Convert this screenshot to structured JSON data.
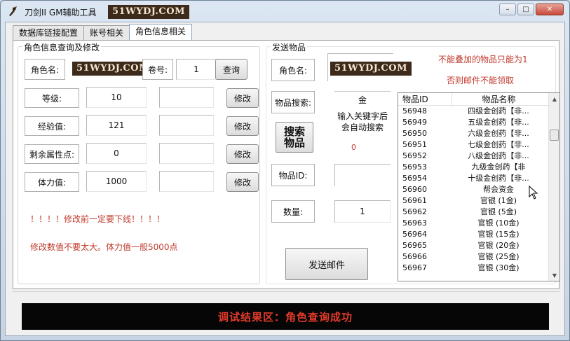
{
  "window": {
    "title": "刀剑II GM辅助工具",
    "watermark": "51WYDJ.COM",
    "controls": {
      "minimize": "–",
      "maximize": "□",
      "close": "✕"
    }
  },
  "tabs": [
    {
      "label": "数据库链接配置"
    },
    {
      "label": "账号相关"
    },
    {
      "label": "角色信息相关"
    }
  ],
  "role_query": {
    "group_title": "角色信息查询及修改",
    "name_label": "角色名:",
    "name_value": "51WYDJ.COM",
    "volume_label": "卷号:",
    "volume_value": "1",
    "query_button": "查询",
    "rows": [
      {
        "label": "等级:",
        "value": "10",
        "button": "修改"
      },
      {
        "label": "经验值:",
        "value": "121",
        "button": "修改"
      },
      {
        "label": "剩余属性点:",
        "value": "0",
        "button": "修改"
      },
      {
        "label": "体力值:",
        "value": "1000",
        "button": "修改"
      }
    ],
    "warning1": "！！！！修改前一定要下线！！！！",
    "warning2": "修改数值不要太大。体力值一般5000点"
  },
  "send_items": {
    "group_title": "发送物品",
    "name_label": "角色名:",
    "name_value": "51WYDJ.COM",
    "notice1": "不能叠加的物品只能为1",
    "notice2": "否则邮件不能领取",
    "search_label": "物品搜索:",
    "search_value": "金",
    "search_hint": "输入关键字后会自动搜索",
    "search_button": "搜索物品",
    "search_count": "0",
    "item_id_label": "物品ID:",
    "item_id_value": "",
    "quantity_label": "数量:",
    "quantity_value": "1",
    "send_button": "发送邮件"
  },
  "item_list": {
    "columns": [
      "物品ID",
      "物品名称"
    ],
    "rows": [
      {
        "id": "56948",
        "name": "四级金创药【非..."
      },
      {
        "id": "56949",
        "name": "五级金创药【非..."
      },
      {
        "id": "56950",
        "name": "六级金创药【非..."
      },
      {
        "id": "56951",
        "name": "七级金创药【非..."
      },
      {
        "id": "56952",
        "name": "八级金创药【非..."
      },
      {
        "id": "56953",
        "name": "九级金创药【非"
      },
      {
        "id": "56954",
        "name": "十级金创药【非..."
      },
      {
        "id": "56960",
        "name": "帮会资金"
      },
      {
        "id": "56961",
        "name": "官银 (1金)"
      },
      {
        "id": "56962",
        "name": "官银 (5金)"
      },
      {
        "id": "56963",
        "name": "官银 (10金)"
      },
      {
        "id": "56964",
        "name": "官银 (15金)"
      },
      {
        "id": "56965",
        "name": "官银 (20金)"
      },
      {
        "id": "56966",
        "name": "官银 (25金)"
      },
      {
        "id": "56967",
        "name": "官银 (30金)"
      }
    ]
  },
  "status": {
    "text": "调试结果区：角色查询成功"
  }
}
